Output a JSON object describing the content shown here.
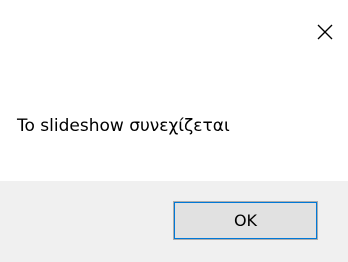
{
  "window": {
    "title": "",
    "close_icon": "close-icon"
  },
  "dialog": {
    "message": "To slideshow συνεχίζεται"
  },
  "buttons": {
    "ok_label": "OK"
  }
}
